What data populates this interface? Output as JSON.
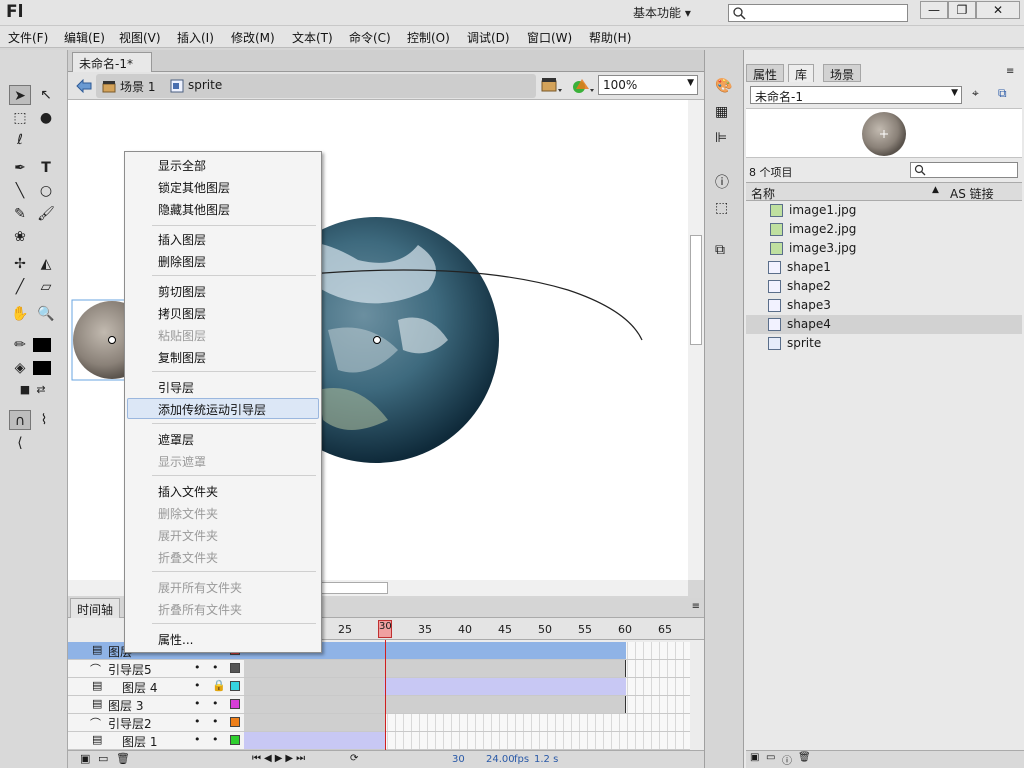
{
  "app": {
    "logo": "Fl",
    "workspace": "基本功能",
    "workspace_arrow": "▾"
  },
  "window_buttons": [
    "—",
    "❐",
    "✕"
  ],
  "menubar": [
    "文件(F)",
    "编辑(E)",
    "视图(V)",
    "插入(I)",
    "修改(M)",
    "文本(T)",
    "命令(C)",
    "控制(O)",
    "调试(D)",
    "窗口(W)",
    "帮助(H)"
  ],
  "document": {
    "tab_label": "未命名-1*",
    "tab_close": "×",
    "scene": "场景 1",
    "symbol": "sprite",
    "zoom": "100%"
  },
  "context_menu": {
    "items": [
      {
        "label": "显示全部",
        "disabled": false
      },
      {
        "label": "锁定其他图层",
        "disabled": false
      },
      {
        "label": "隐藏其他图层",
        "disabled": false
      },
      {
        "label": "插入图层",
        "disabled": false
      },
      {
        "label": "删除图层",
        "disabled": false
      },
      {
        "label": "剪切图层",
        "disabled": false
      },
      {
        "label": "拷贝图层",
        "disabled": false
      },
      {
        "label": "粘贴图层",
        "disabled": true
      },
      {
        "label": "复制图层",
        "disabled": false
      },
      {
        "label": "引导层",
        "disabled": false
      },
      {
        "label": "添加传统运动引导层",
        "disabled": false,
        "highlighted": true
      },
      {
        "label": "遮罩层",
        "disabled": false
      },
      {
        "label": "显示遮罩",
        "disabled": true
      },
      {
        "label": "插入文件夹",
        "disabled": false
      },
      {
        "label": "删除文件夹",
        "disabled": true
      },
      {
        "label": "展开文件夹",
        "disabled": true
      },
      {
        "label": "折叠文件夹",
        "disabled": true
      },
      {
        "label": "展开所有文件夹",
        "disabled": true
      },
      {
        "label": "折叠所有文件夹",
        "disabled": true
      },
      {
        "label": "属性...",
        "disabled": false
      }
    ]
  },
  "timeline": {
    "tab_label": "时间轴",
    "ruler": [
      "25",
      "30",
      "35",
      "40",
      "45",
      "50",
      "55",
      "60",
      "65"
    ],
    "playhead_frame": "30",
    "layers": [
      {
        "name": "图层",
        "kind": "layer",
        "color": "#d94040",
        "selected": true
      },
      {
        "name": "引导层5",
        "kind": "guide",
        "color": "#555555"
      },
      {
        "name": "图层 4",
        "kind": "layer",
        "color": "#36d4e0",
        "locked": true
      },
      {
        "name": "图层 3",
        "kind": "layer",
        "color": "#d83fd8"
      },
      {
        "name": "引导层2",
        "kind": "guide",
        "color": "#ee7f1a"
      },
      {
        "name": "图层 1",
        "kind": "layer",
        "color": "#2fcf2f"
      }
    ],
    "status": {
      "frame": "30",
      "fps": "24.00",
      "fps_unit": "fps",
      "time": "1.2 s"
    }
  },
  "panel": {
    "tabs": [
      "属性",
      "库",
      "场景"
    ],
    "active_tab": "库",
    "library_name": "未命名-1",
    "item_count": "8 个项目",
    "col_name": "名称",
    "col_linkage": "AS 链接",
    "items": [
      {
        "name": "image1.jpg",
        "type": "bitmap"
      },
      {
        "name": "image2.jpg",
        "type": "bitmap"
      },
      {
        "name": "image3.jpg",
        "type": "bitmap"
      },
      {
        "name": "shape1",
        "type": "graphic"
      },
      {
        "name": "shape2",
        "type": "graphic"
      },
      {
        "name": "shape3",
        "type": "graphic"
      },
      {
        "name": "shape4",
        "type": "graphic",
        "selected": true
      },
      {
        "name": "sprite",
        "type": "movieclip"
      }
    ]
  }
}
